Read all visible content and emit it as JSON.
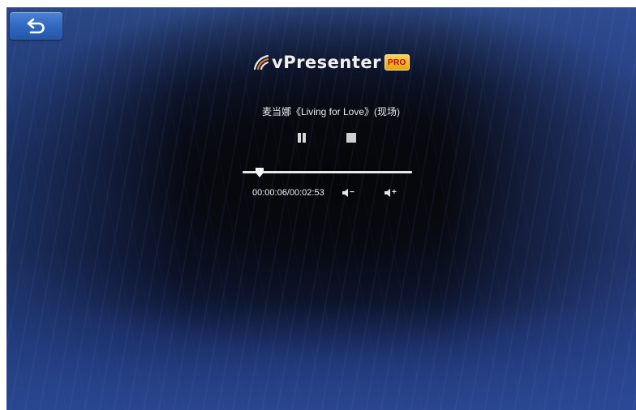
{
  "app": {
    "brand_name": "vPresenter",
    "brand_badge": "PRO"
  },
  "player": {
    "track_title": "麦当娜《Living for Love》(现场)",
    "elapsed": "00:00:06",
    "duration": "00:02:53",
    "time_display": "00:00:06/00:02:53",
    "progress_fraction": 0.035,
    "state": "playing"
  },
  "controls": {
    "volume_down_sign": "−",
    "volume_up_sign": "+"
  },
  "icons": {
    "back": "back-arrow-icon",
    "logo": "vpresenter-logo-icon",
    "pause": "pause-icon",
    "stop": "stop-icon",
    "volume_down": "volume-down-icon",
    "volume_up": "volume-up-icon"
  },
  "colors": {
    "back_button": "#3a72c9",
    "badge_gold": "#f2b600",
    "badge_text": "#b0001e",
    "text": "#ececec"
  }
}
